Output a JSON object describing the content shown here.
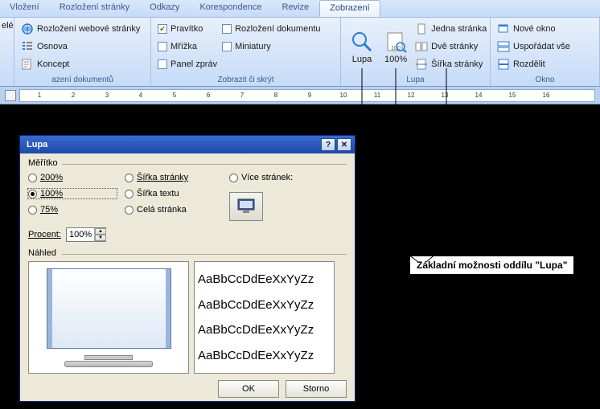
{
  "tabs": {
    "t0": "Vložení",
    "t1": "Rozložení stránky",
    "t2": "Odkazy",
    "t3": "Korespondence",
    "t4": "Revize",
    "t5": "Zobrazení"
  },
  "ribbon": {
    "views": {
      "web_layout": "Rozložení webové stránky",
      "outline": "Osnova",
      "draft": "Koncept",
      "group_label": "azení dokumentů"
    },
    "show_hide": {
      "ruler": "Pravítko",
      "gridlines": "Mřížka",
      "message_bar": "Panel zpráv",
      "doc_map": "Rozložení dokumentu",
      "thumbnails": "Miniatury",
      "group_label": "Zobrazit či skrýt"
    },
    "zoom": {
      "zoom_btn": "Lupa",
      "hundred": "100%",
      "one_page": "Jedna stránka",
      "two_pages": "Dvě stránky",
      "page_width": "Šířka stránky",
      "group_label": "Lupa"
    },
    "window": {
      "new_window": "Nové okno",
      "arrange_all": "Uspořádat vše",
      "split": "Rozdělit",
      "group_label": "Okno"
    }
  },
  "ruler_ticks": [
    "1",
    "2",
    "3",
    "4",
    "5",
    "6",
    "7",
    "8",
    "9",
    "10",
    "11",
    "12",
    "13",
    "14",
    "15",
    "16"
  ],
  "dialog": {
    "title": "Lupa",
    "scale_label": "Měřítko",
    "r200": "200%",
    "r100": "100%",
    "r75": "75%",
    "r_page_width": "Šířka stránky",
    "r_text_width": "Šířka textu",
    "r_whole_page": "Celá stránka",
    "r_many_pages": "Více stránek:",
    "percent_label": "Procent:",
    "percent_value": "100%",
    "preview_label": "Náhled",
    "sample_line": "AaBbCcDdEeXxYyZz",
    "ok": "OK",
    "cancel": "Storno"
  },
  "callout": "Základní možnosti oddílu \"Lupa\""
}
